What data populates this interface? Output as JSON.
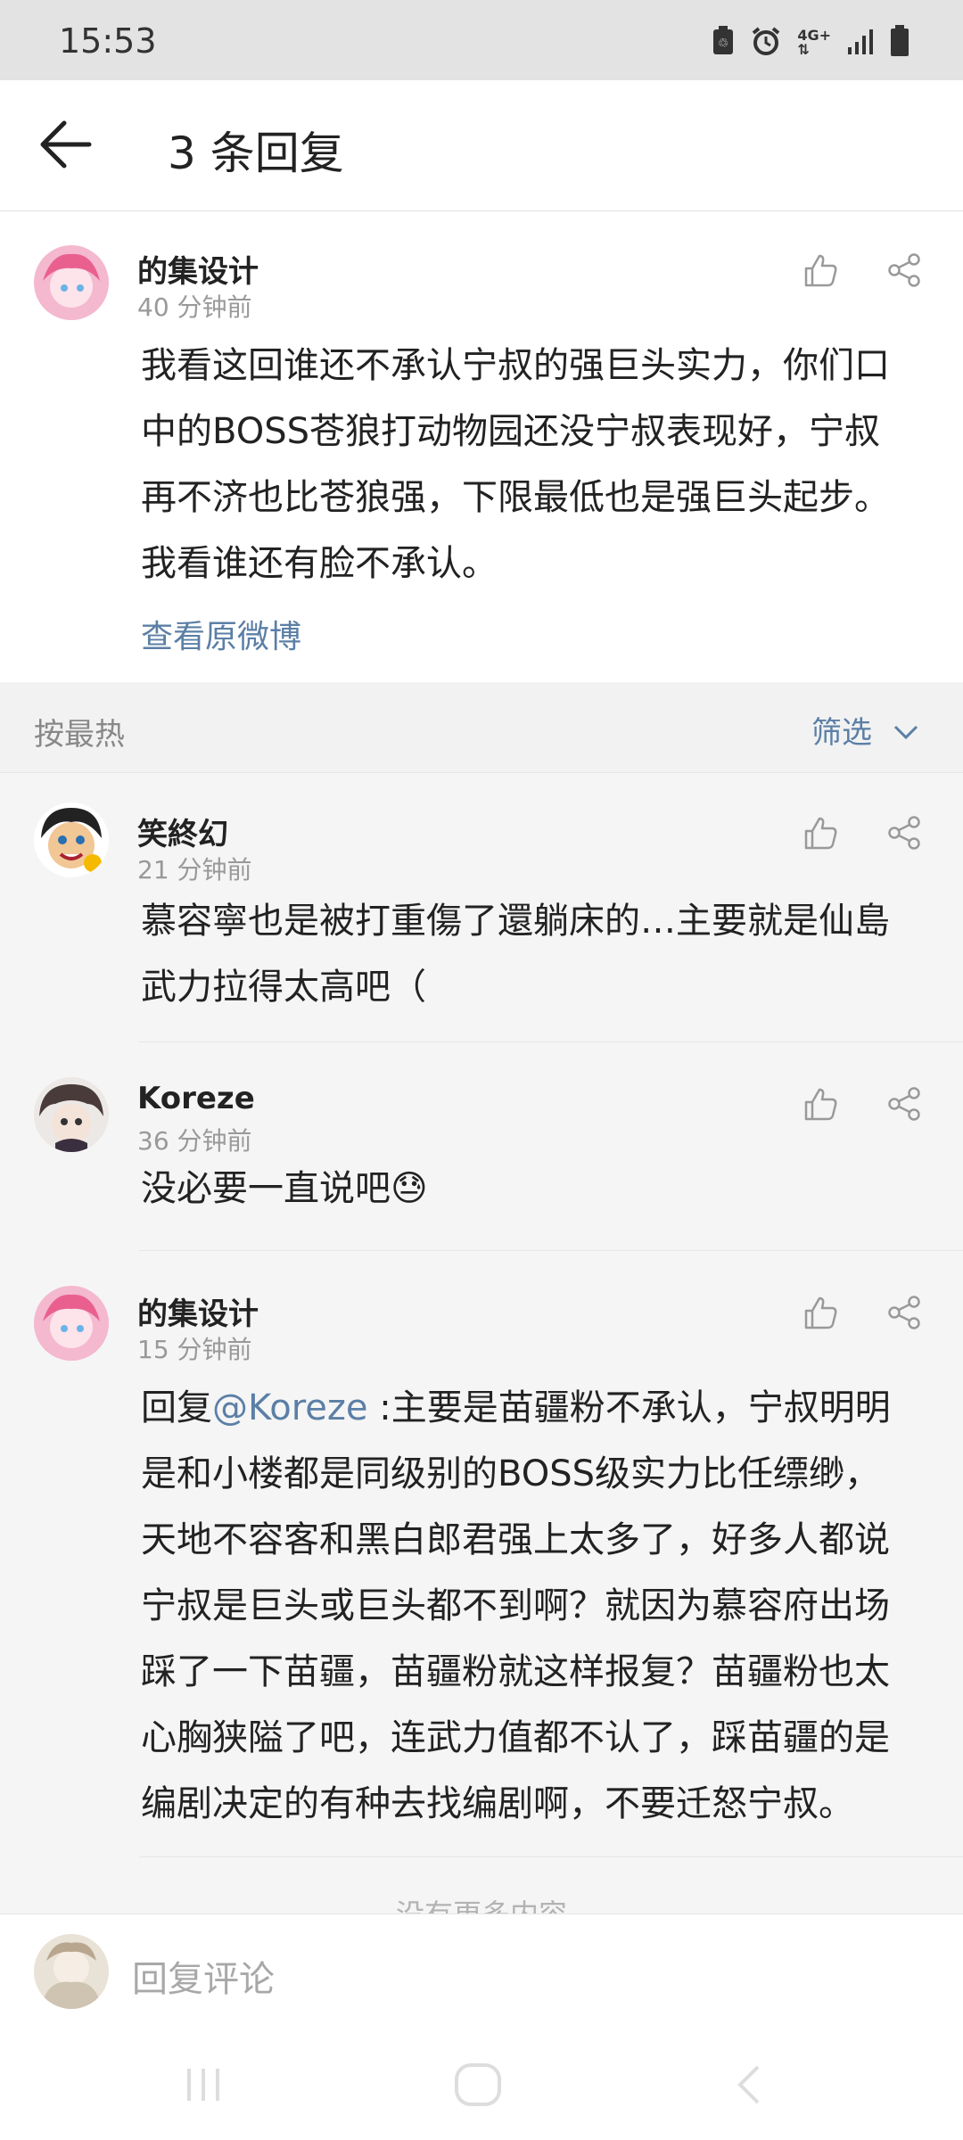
{
  "status_bar": {
    "time": "15:53",
    "network": "4G+"
  },
  "header": {
    "title": "3 条回复"
  },
  "main_comment": {
    "username": "的集设计",
    "time": "40 分钟前",
    "text_lines": [
      "我看这回谁还不承认宁叔的强巨头实力，你们口",
      "中的BOSS苍狼打动物园还没宁叔表现好，宁叔",
      "再不济也比苍狼强，下限最低也是强巨头起步。",
      "我看谁还有脸不承认。"
    ],
    "link": "查看原微博"
  },
  "sort": {
    "label": "按最热",
    "filter": "筛选"
  },
  "replies": [
    {
      "username": "笑終幻",
      "time": "21 分钟前",
      "text_lines": [
        "慕容寧也是被打重傷了還躺床的…主要就是仙島",
        "武力拉得太高吧（"
      ]
    },
    {
      "username": "Koreze",
      "time": "36 分钟前",
      "text_lines": [
        "没必要一直说吧😓"
      ]
    },
    {
      "username": "的集设计",
      "time": "15 分钟前",
      "reply_prefix": "回复",
      "mention": "@Koreze",
      "text_lines": [
        " :主要是苗疆粉不承认，宁叔明明",
        "是和小楼都是同级别的BOSS级实力比任缥缈，",
        "天地不容客和黑白郎君强上太多了，好多人都说",
        "宁叔是巨头或巨头都不到啊？就因为慕容府出场",
        "踩了一下苗疆，苗疆粉就这样报复？苗疆粉也太",
        "心胸狭隘了吧，连武力值都不认了，踩苗疆的是",
        "编剧决定的有种去找编剧啊，不要迁怒宁叔。"
      ]
    }
  ],
  "footer_text": "没有更多内容",
  "input": {
    "placeholder": "回复评论"
  }
}
